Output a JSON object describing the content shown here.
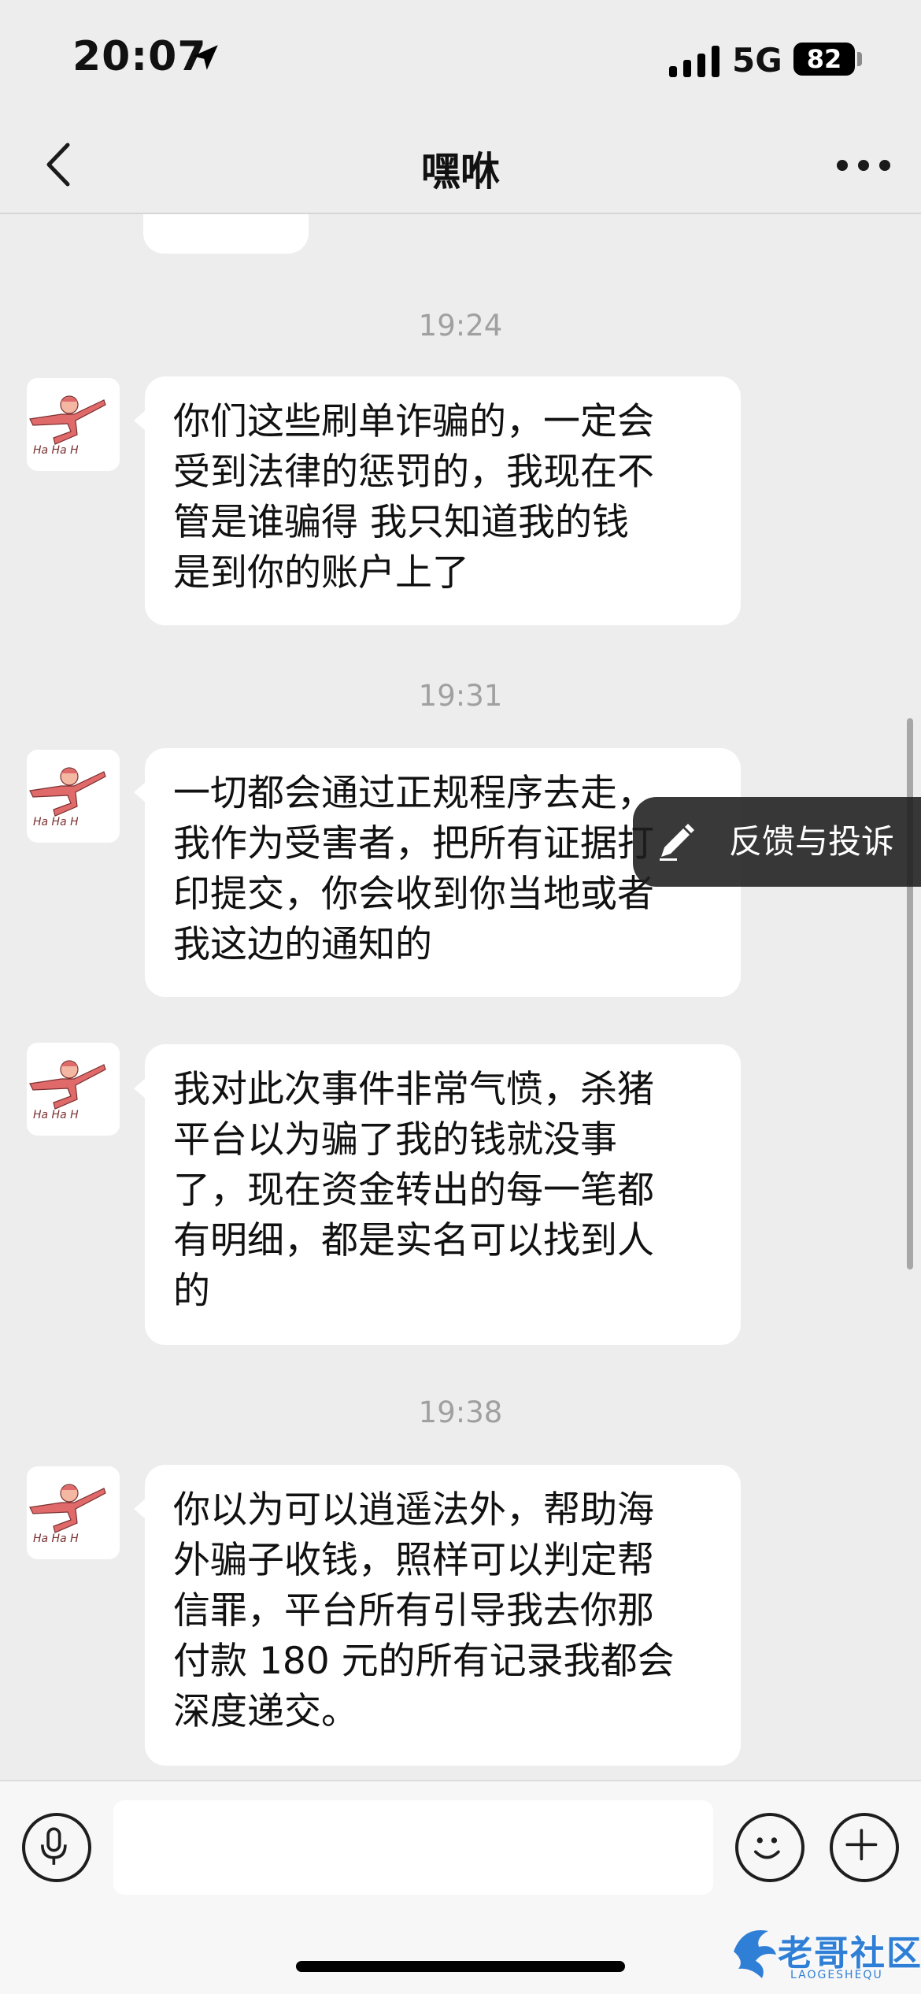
{
  "status_bar": {
    "time": "20:07",
    "network": "5G",
    "battery": "82"
  },
  "header": {
    "title": "嘿咻",
    "back_icon": "chevron-left-icon",
    "more_icon": "more-dots-icon"
  },
  "messages": [
    {
      "timestamp": "19:24",
      "text": "你们这些刷单诈骗的，一定会\n受到法律的惩罚的，我现在不\n管是谁骗得 我只知道我的钱\n是到你的账户上了"
    },
    {
      "timestamp": "19:31",
      "text": "一切都会通过正规程序去走，\n我作为受害者，把所有证据打\n印提交，你会收到你当地或者\n我这边的通知的"
    },
    {
      "timestamp": "",
      "text": "我对此次事件非常气愤，杀猪\n平台以为骗了我的钱就没事\n了，现在资金转出的每一笔都\n有明细，都是实名可以找到人\n的"
    },
    {
      "timestamp": "19:38",
      "text": "你以为可以逍遥法外，帮助海\n外骗子收钱，照样可以判定帮\n信罪，平台所有引导我去你那\n付款 180 元的所有记录我都会\n深度递交。"
    }
  ],
  "feedback": {
    "label": "反馈与投诉",
    "icon": "pencil-icon"
  },
  "input_bar": {
    "voice_icon": "microphone-icon",
    "emoji_icon": "smiley-icon",
    "plus_icon": "plus-icon",
    "placeholder": ""
  },
  "watermark": {
    "text": "老哥社区",
    "subtext": "LAOGESHEQU"
  },
  "colors": {
    "background": "#ededed",
    "bubble": "#ffffff",
    "timestamp": "#a0a0a0",
    "avatar_figure": "#e06a6a"
  }
}
